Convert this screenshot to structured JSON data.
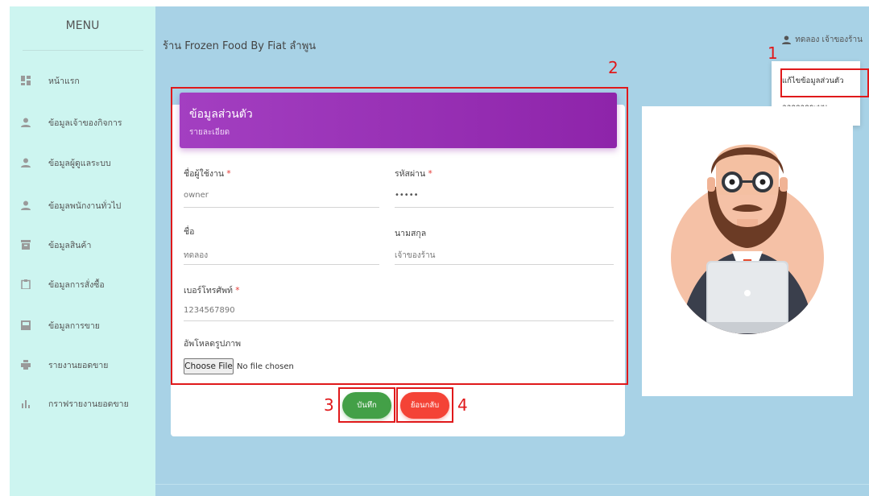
{
  "sidebar": {
    "title": "MENU",
    "items": [
      {
        "label": "หน้าแรก",
        "icon": "dashboard-icon"
      },
      {
        "label": "ข้อมูลเจ้าของกิจการ",
        "icon": "person-icon"
      },
      {
        "label": "ข้อมูลผู้ดูแลระบบ",
        "icon": "person-icon"
      },
      {
        "label": "ข้อมูลพนักงานทั่วไป",
        "icon": "person-icon"
      },
      {
        "label": "ข้อมูลสินค้า",
        "icon": "archive-icon"
      },
      {
        "label": "ข้อมูลการสั่งซื้อ",
        "icon": "clipboard-icon"
      },
      {
        "label": "ข้อมูลการขาย",
        "icon": "inbox-icon"
      },
      {
        "label": "รายงานยอดขาย",
        "icon": "print-icon"
      },
      {
        "label": "กราฟรายงานยอดขาย",
        "icon": "bar-chart-icon"
      }
    ]
  },
  "header": {
    "shop_title": "ร้าน Frozen Food By Fiat ลำพูน",
    "user_name": "ทดลอง เจ้าของร้าน"
  },
  "user_dropdown": {
    "items": [
      "แก้ไขข้อมูลส่วนตัว",
      "ออกจากระบบ"
    ]
  },
  "form": {
    "title": "ข้อมูลส่วนตัว",
    "subtitle": "รายละเอียด",
    "username_label": "ชื่อผู้ใช้งาน",
    "username_value": "owner",
    "password_label": "รหัสผ่าน",
    "password_value": "•••••",
    "firstname_label": "ชื่อ",
    "firstname_value": "ทดลอง",
    "lastname_label": "นามสกุล",
    "lastname_value": "เจ้าของร้าน",
    "phone_label": "เบอร์โทรศัพท์",
    "phone_value": "1234567890",
    "upload_label": "อัพโหลดรูปภาพ",
    "choose_file_label": "Choose File",
    "no_file_text": "No file chosen",
    "required_mark": "*"
  },
  "buttons": {
    "save_label": "บันทึก",
    "back_label": "ย้อนกลับ"
  },
  "annotations": [
    "1",
    "2",
    "3",
    "4"
  ],
  "colors": {
    "background": "#a8d2e6",
    "sidebar": "#cdf5f0",
    "header_purple": "#9c27b0",
    "save_green": "#43a047",
    "back_red": "#f44336",
    "annotation_red": "#e0191b"
  }
}
